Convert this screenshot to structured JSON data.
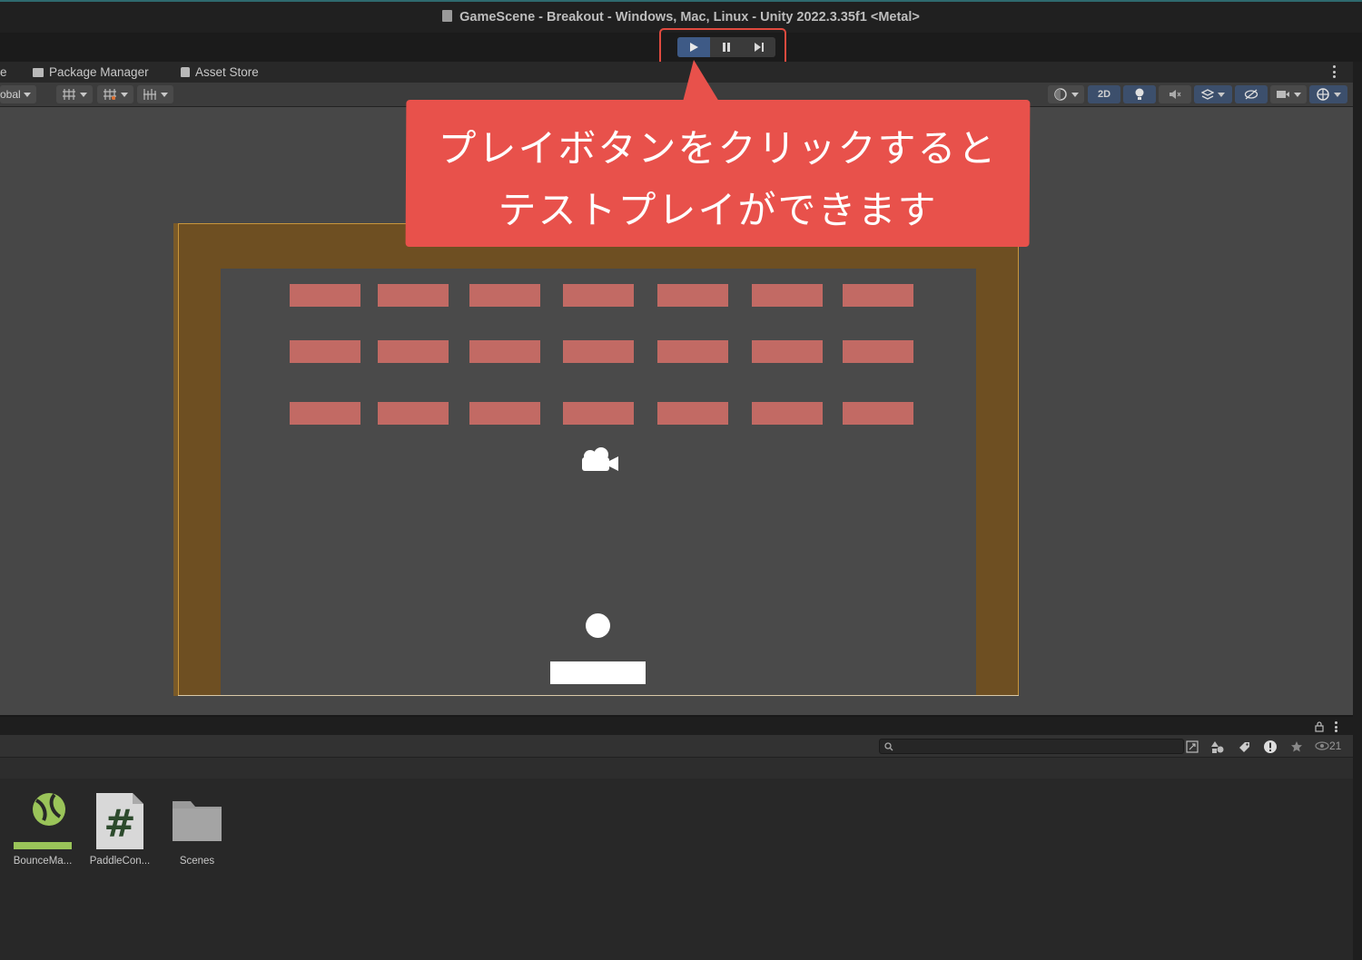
{
  "window": {
    "title": "GameScene - Breakout - Windows, Mac, Linux - Unity 2022.3.35f1 <Metal>"
  },
  "play_controls": {
    "play": "play-icon",
    "pause": "pause-icon",
    "step": "step-icon"
  },
  "tabs": [
    {
      "label": "e"
    },
    {
      "label": "Package Manager",
      "icon": "package-icon"
    },
    {
      "label": "Asset Store",
      "icon": "store-icon"
    }
  ],
  "scene_toolbar": {
    "pivot_global_label": "obal",
    "mode_2d_label": "2D"
  },
  "callout": {
    "line1": "プレイボタンをクリックすると",
    "line2": "テストプレイができます",
    "color": "#e8514b"
  },
  "scene": {
    "brick_color": "#c26a64",
    "wall_color": "#6e4f22",
    "brick_rows": 3,
    "brick_cols": 7
  },
  "project": {
    "search_placeholder": "",
    "hidden_count": "21",
    "assets": [
      {
        "name": "BounceMa...",
        "icon": "physics-material-icon"
      },
      {
        "name": "PaddleCon...",
        "icon": "csharp-script-icon"
      },
      {
        "name": "Scenes",
        "icon": "folder-icon"
      }
    ]
  }
}
